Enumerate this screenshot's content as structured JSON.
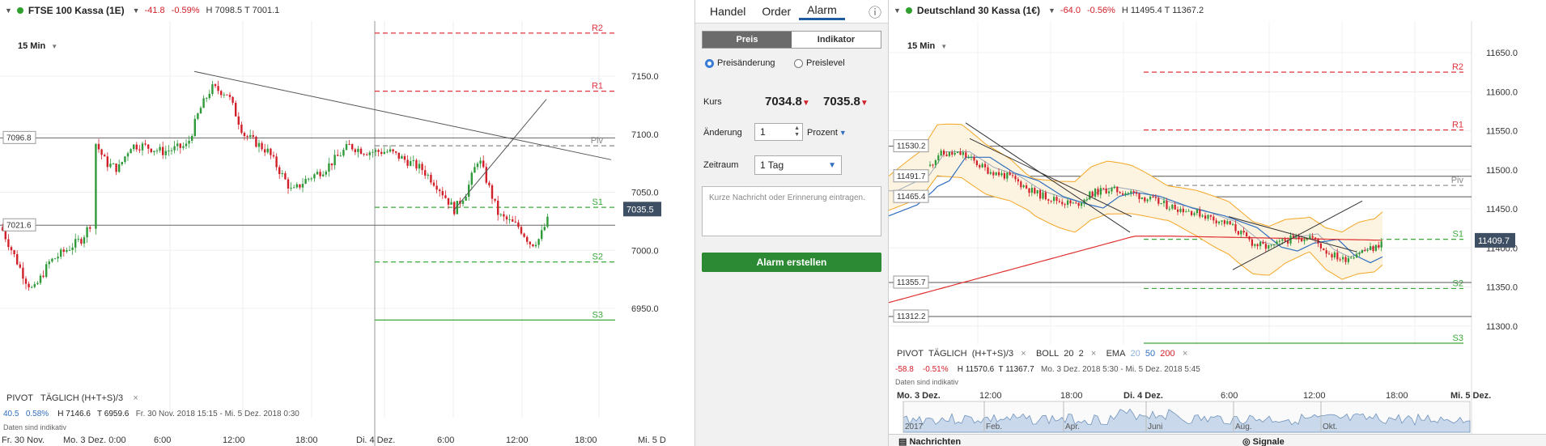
{
  "left": {
    "instrument": "FTSE 100 Kassa (1E)",
    "change": "-41.8",
    "change_pct": "-0.59%",
    "hl": "H 7098.5  T 7001.1",
    "timeframe": "15 Min",
    "levels": {
      "r2": "R2",
      "r1": "R1",
      "piv": "Piv",
      "s1": "S1",
      "s2": "S2",
      "s3": "S3"
    },
    "yticks": [
      "7150.0",
      "7100.0",
      "7050.0",
      "7000.0",
      "6950.0"
    ],
    "tags": {
      "t1": "7096.8",
      "t2": "7021.6",
      "current": "7035.5"
    },
    "indicator": {
      "label": "PIVOT",
      "detail": "TÄGLICH (H+T+S)/3",
      "close_icon": "×"
    },
    "stats": {
      "v1": "40.5",
      "v2": "0.58%",
      "h": "H 7146.6",
      "t": "T 6959.6",
      "range": "Fr. 30 Nov. 2018 15:15 - Mi. 5 Dez. 2018 0:30"
    },
    "note": "Daten sind indikativ",
    "xlabels": [
      "Fr. 30 Nov.",
      "Mo. 3 Dez. 0:00",
      "6:00",
      "12:00",
      "18:00",
      "Di. 4 Dez.",
      "6:00",
      "12:00",
      "18:00",
      "Mi. 5 D"
    ]
  },
  "alarm": {
    "tabs": [
      "Handel",
      "Order",
      "Alarm"
    ],
    "active_tab": "Alarm",
    "info_icon": "ⓘ",
    "segments": [
      "Preis",
      "Indikator"
    ],
    "radio": [
      "Preisänderung",
      "Preislevel"
    ],
    "kurs_label": "Kurs",
    "bid": "7034.8",
    "ask": "7035.8",
    "aenderung_label": "Änderung",
    "aenderung_value": "1",
    "unit": "Prozent",
    "zeitraum_label": "Zeitraum",
    "zeitraum_value": "1 Tag",
    "note_placeholder": "Kurze Nachricht oder Erinnerung eintragen.",
    "button": "Alarm erstellen"
  },
  "right": {
    "instrument": "Deutschland 30 Kassa (1€)",
    "change": "-64.0",
    "change_pct": "-0.56%",
    "hl": "H 11495.4  T 11367.2",
    "timeframe": "15 Min",
    "levels": {
      "r2": "R2",
      "r1": "R1",
      "piv": "Piv",
      "s1": "S1",
      "s2": "S2",
      "s3": "S3"
    },
    "yticks": [
      "11650.0",
      "11600.0",
      "11550.0",
      "11500.0",
      "11450.0",
      "11400.0",
      "11350.0",
      "11300.0"
    ],
    "tags": {
      "t1": "11530.2",
      "t2": "11491.7",
      "t3": "11465.4",
      "t4": "11355.7",
      "t5": "11312.2",
      "current": "11409.7"
    },
    "indicators": [
      "PIVOT",
      "TÄGLICH",
      "(H+T+S)/3",
      "BOLL",
      "20",
      "2",
      "EMA",
      "20",
      "50",
      "200"
    ],
    "close_icon": "×",
    "stats": {
      "v1": "-58.8",
      "v2": "-0.51%",
      "h": "H 11570.6",
      "t": "T 11367.7",
      "range": "Mo. 3 Dez. 2018 5:30 - Mi. 5 Dez. 2018 5:45"
    },
    "note": "Daten sind indikativ",
    "xlabels": [
      "Mo. 3 Dez.",
      "12:00",
      "18:00",
      "Di. 4 Dez.",
      "6:00",
      "12:00",
      "18:00",
      "Mi. 5 Dez."
    ],
    "nav_labels": [
      "2017",
      "Feb.",
      "Apr.",
      "Juni",
      "Aug.",
      "Okt."
    ],
    "bottom_tabs": [
      "Nachrichten",
      "Signale"
    ]
  },
  "colors": {
    "up": "#2f9a3a",
    "down": "#d2202a",
    "pivot_red": "#e0333d",
    "pivot_green": "#3aa93a",
    "boll": "#f4a623",
    "ema20": "#9aaabb",
    "ema50": "#2f6fbf",
    "ema200": "#e03030"
  }
}
